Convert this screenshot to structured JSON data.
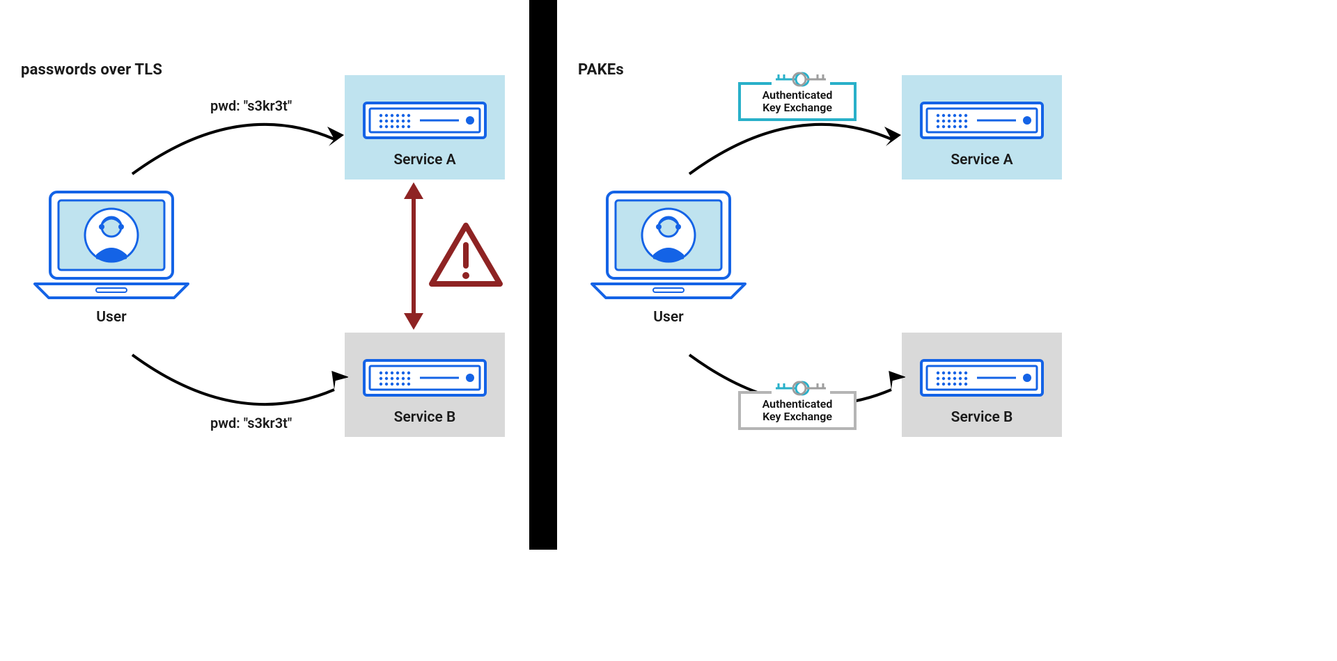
{
  "left": {
    "title": "passwords over TLS",
    "user_label": "User",
    "flow_top": "pwd: \"s3kr3t\"",
    "flow_bottom": "pwd: \"s3kr3t\"",
    "service_a": "Service A",
    "service_b": "Service B"
  },
  "right": {
    "title": "PAKEs",
    "user_label": "User",
    "ake_top_line1": "Authenticated",
    "ake_top_line2": "Key Exchange",
    "ake_bottom_line1": "Authenticated",
    "ake_bottom_line2": "Key Exchange",
    "service_a": "Service A",
    "service_b": "Service B"
  },
  "colors": {
    "blue": "#1463e6",
    "lightblue": "#bfe3ef",
    "teal": "#29b0c9",
    "gray": "#d9d9d9",
    "danger": "#8e2323"
  }
}
